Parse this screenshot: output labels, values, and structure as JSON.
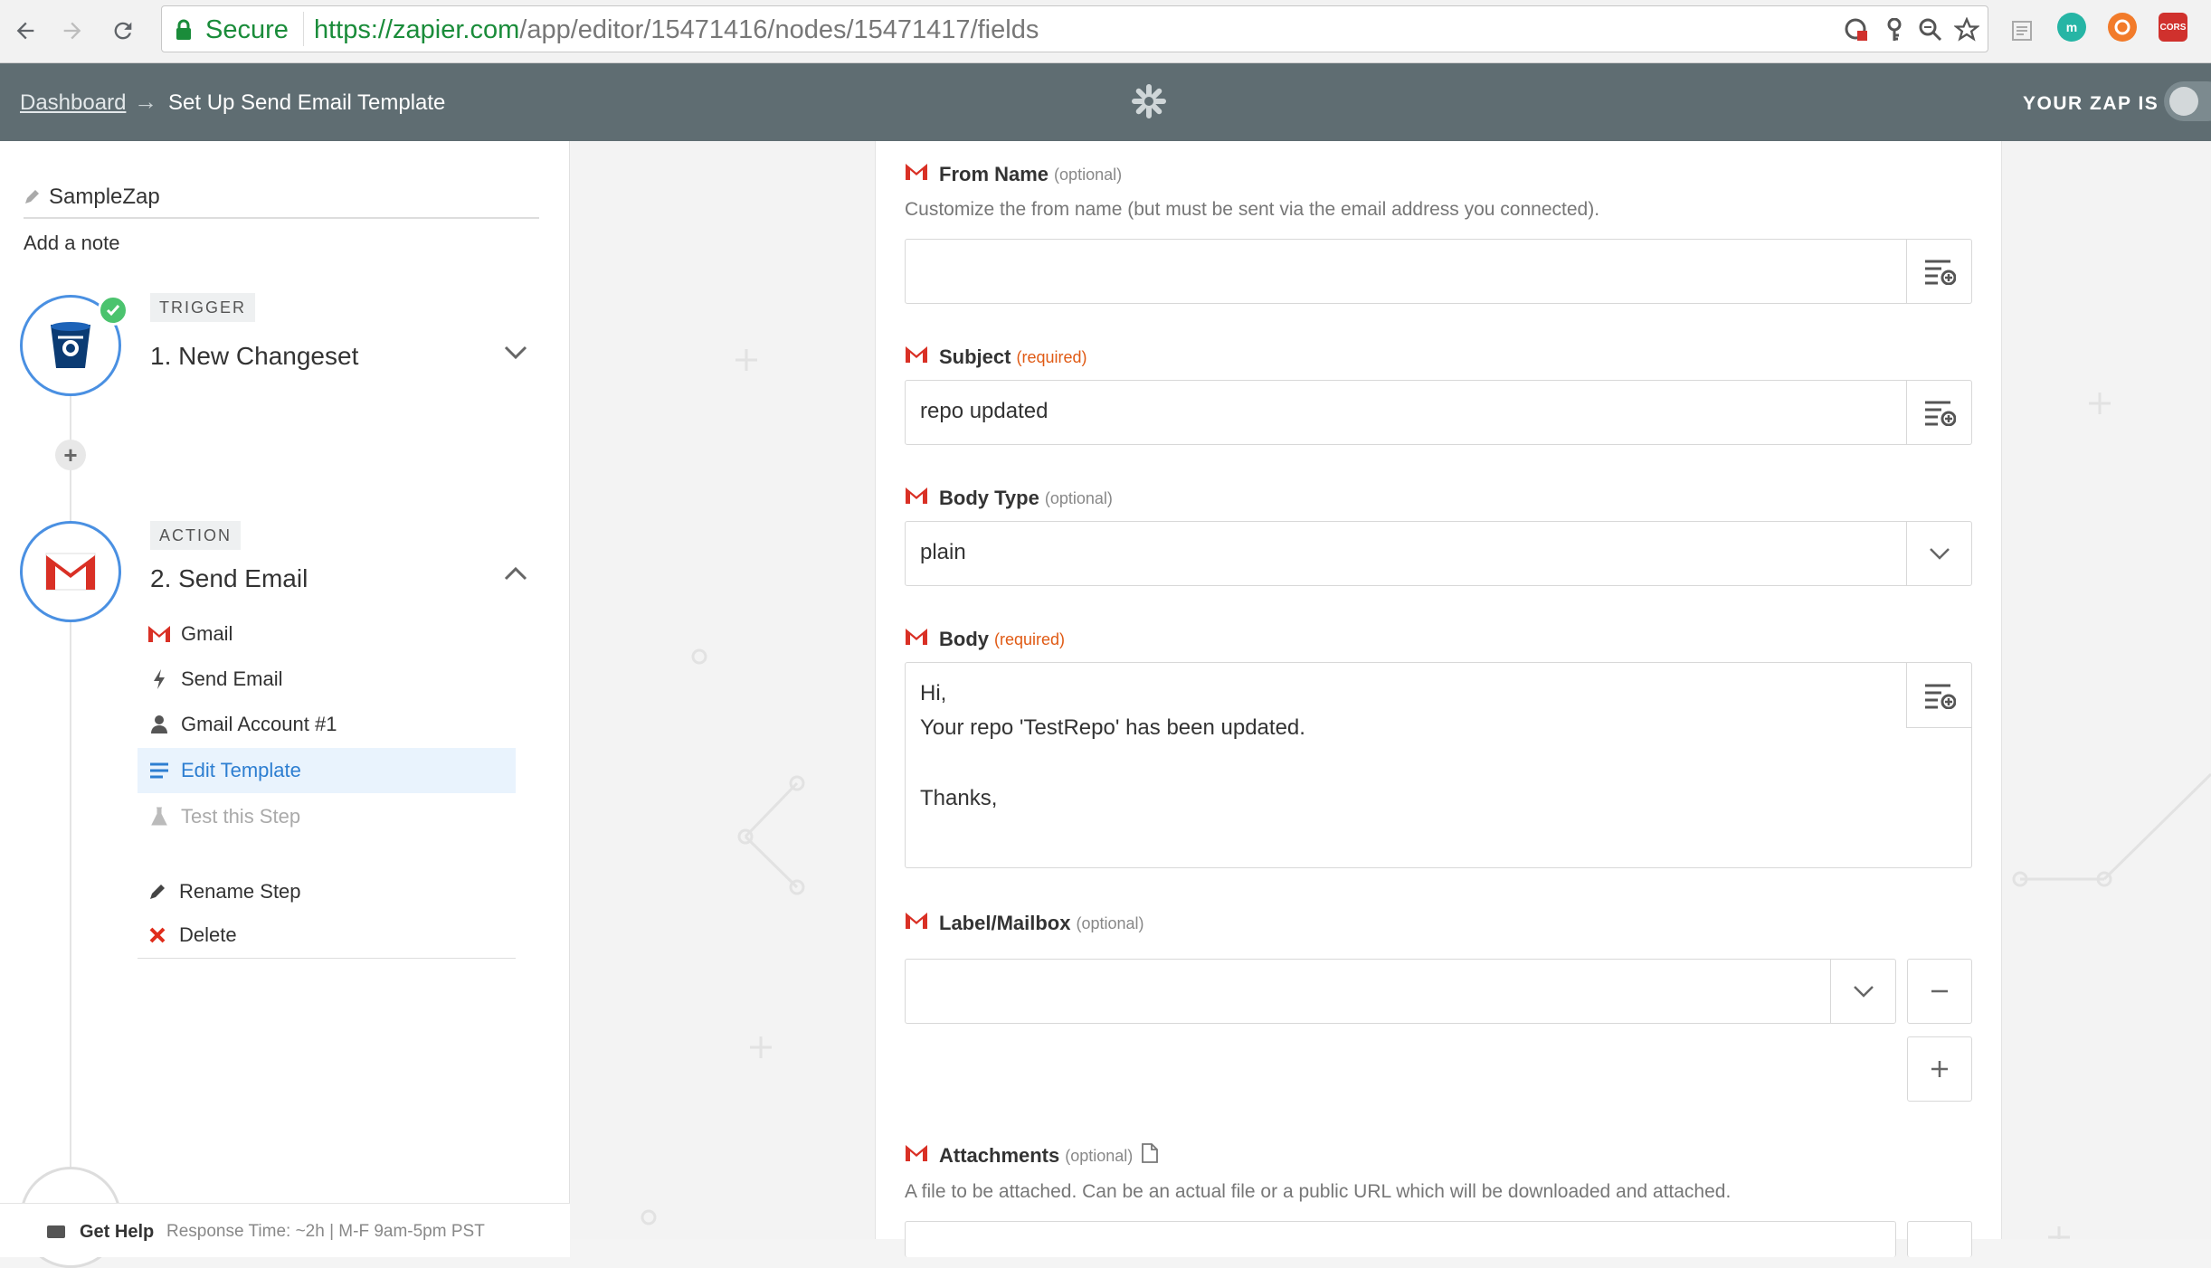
{
  "browser": {
    "secure_label": "Secure",
    "url_scheme": "https://",
    "url_host": "zapier.com",
    "url_path": "/app/editor/15471416/nodes/15471417/fields",
    "extensions": [
      {
        "name": "m",
        "color": "#26b5a5"
      },
      {
        "name": "",
        "color": "#f27b2a"
      },
      {
        "name": "CORS",
        "color": "#d0312d"
      }
    ]
  },
  "header": {
    "breadcrumb_link": "Dashboard",
    "breadcrumb_arrow": "→",
    "page_title": "Set Up Send Email Template",
    "zap_status_label": "YOUR ZAP IS"
  },
  "sidebar": {
    "zap_name": "SampleZap",
    "add_note": "Add a note",
    "trigger": {
      "badge": "TRIGGER",
      "title": "1. New Changeset"
    },
    "action": {
      "badge": "ACTION",
      "title": "2. Send Email",
      "items": [
        {
          "label": "Gmail"
        },
        {
          "label": "Send Email"
        },
        {
          "label": "Gmail Account #1"
        },
        {
          "label": "Edit Template"
        },
        {
          "label": "Test this Step"
        }
      ],
      "rename": "Rename Step",
      "delete": "Delete"
    },
    "help": {
      "label": "Get Help",
      "meta": "Response Time: ~2h  |  M-F 9am-5pm PST"
    }
  },
  "form": {
    "from_name": {
      "label": "From Name",
      "tag": "(optional)",
      "help": "Customize the from name (but must be sent via the email address you connected).",
      "value": ""
    },
    "subject": {
      "label": "Subject",
      "tag": "(required)",
      "value": "repo updated"
    },
    "body_type": {
      "label": "Body Type",
      "tag": "(optional)",
      "value": "plain"
    },
    "body": {
      "label": "Body",
      "tag": "(required)",
      "lines": [
        "Hi,",
        "Your repo 'TestRepo' has been updated.",
        "",
        "Thanks,",
        ""
      ]
    },
    "label_mailbox": {
      "label": "Label/Mailbox",
      "tag": "(optional)",
      "value": ""
    },
    "attachments": {
      "label": "Attachments",
      "tag": "(optional)",
      "help": "A file to be attached. Can be an actual file or a public URL which will be downloaded and attached."
    }
  },
  "colors": {
    "accent": "#4a90e2",
    "header_bg": "#5f6d72",
    "required": "#e05a14",
    "success": "#4bc36e"
  }
}
